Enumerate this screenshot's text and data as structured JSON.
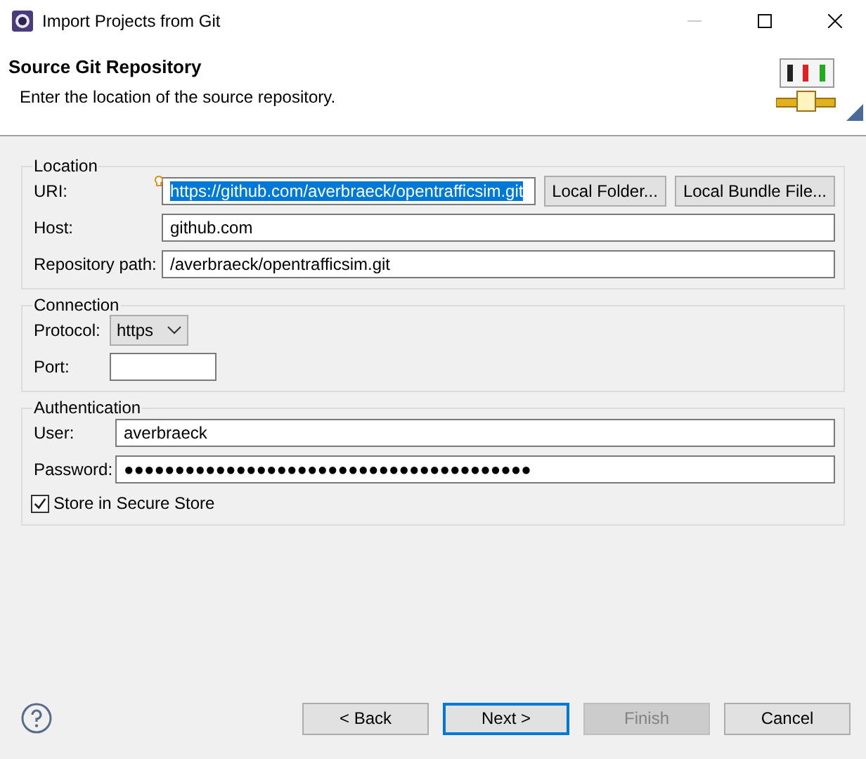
{
  "window": {
    "title": "Import Projects from Git"
  },
  "header": {
    "title": "Source Git Repository",
    "description": "Enter the location of the source repository."
  },
  "groups": [
    {
      "title": "Location",
      "fields": [
        {
          "kind": "text",
          "label": "URI:",
          "value": "https://github.com/averbraeck/opentrafficsim.git",
          "selected": true,
          "hint": true,
          "buttons": [
            "Local Folder...",
            "Local Bundle File..."
          ]
        },
        {
          "kind": "text",
          "label": "Host:",
          "value": "github.com",
          "selected": false
        },
        {
          "kind": "text",
          "label": "Repository path:",
          "value": "/averbraeck/opentrafficsim.git",
          "selected": false
        }
      ]
    },
    {
      "title": "Connection",
      "fields": [
        {
          "kind": "combo",
          "label": "Protocol:",
          "value": "https"
        },
        {
          "kind": "short",
          "label": "Port:"
        }
      ]
    },
    {
      "title": "Authentication",
      "fields": [
        {
          "kind": "text",
          "label": "User:",
          "value": "averbraeck",
          "selected": false
        },
        {
          "kind": "text",
          "label": "Password:",
          "value": "●●●●●●●●●●●●●●●●●●●●●●●●●●●●●●●●●●●●●●●●",
          "selected": false
        }
      ],
      "checkbox": {
        "label": "Store in Secure Store",
        "checked": true
      }
    }
  ],
  "buttons": [
    {
      "label": "< Back",
      "disabled": false,
      "default": false
    },
    {
      "label": "Next >",
      "disabled": false,
      "default": true
    },
    {
      "label": "Finish",
      "disabled": true,
      "default": false
    },
    {
      "label": "Cancel",
      "disabled": false,
      "default": false
    }
  ]
}
